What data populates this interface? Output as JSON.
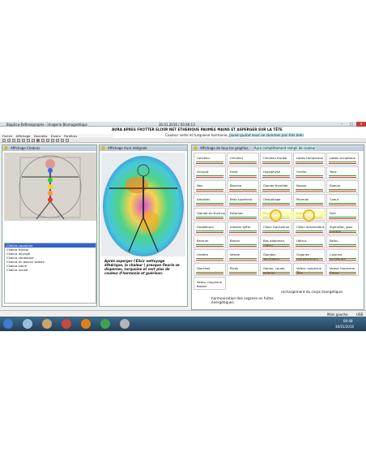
{
  "window": {
    "title": "Bioptica-Reflexographe - Imagerie Biomagnétique",
    "datetime": "30.01.2016 / 00:46:13"
  },
  "banner": {
    "line1": "AURA APRES FROTTER ELIXIR NET ETHERIQUE PAUMES MAINS ET ASPERGER SUR LA TÊTE",
    "line2_text": "Couleur verte et turquoise harmonie,",
    "line2_highlight": "Jaune quand nous ne sommes pas très bien"
  },
  "menu": [
    "Fichier",
    "Affichage",
    "Données",
    "Divers",
    "Fenêtres"
  ],
  "chakras_panel": {
    "title": "Affichage Chakras",
    "items": [
      "Chakra couronne",
      "Chakra frontal",
      "Chakra laryngé",
      "Chakra cardiaque",
      "Chakra du plexus solaire",
      "Chakra sacré",
      "Chakra racine"
    ]
  },
  "aura_panel": {
    "title": "Affichage Aura intégrale",
    "note": "Après asperger l'Élixir nettoyage éthérique, la chaleur ( presque fleurie se disperses, turquoise et vert plus de couleur d'harmonie et guérison."
  },
  "graphs_panel": {
    "title": "Affichage de tous les graphes",
    "banner": "Aura complètement rempli de couleur",
    "cells": [
      "Cerveau",
      "Cerveau",
      "Cerveau frontal",
      "Lobes temporaux",
      "Lobes occipitaux",
      "Occiput",
      "Front",
      "Hypophyse",
      "Oreille",
      "Yeux",
      "Nez",
      "Bouche",
      "Glande thyroïde",
      "Nuque",
      "Epaule",
      "Aisselles",
      "Bras supérieur",
      "Oesophage",
      "Poumon",
      "Coeur",
      "Glande du thymus",
      "Estomac",
      "Pancréas",
      "Rate",
      "Foie",
      "Duodénum",
      "Intestin grêle",
      "Côlon transverse",
      "Côlon descendant",
      "Sigmoïde, gros intestin",
      "Rectum",
      "Bassin",
      "Bas abdomen, région",
      "Utérus",
      "Reins",
      "Uretère",
      "Vessie",
      "Glandes surrénales",
      "Organes reproducteurs",
      "Colonne vertébrale",
      "Hanches",
      "Pieds",
      "Genou, coude, poignet",
      "Valeur moyenne Tête",
      "Valeur moyenne Corps"
    ],
    "last_cell": "Valeur moyenne Bassin",
    "caption_left": "harmonisation des organes en fuites énergétiques.",
    "caption_right": "rechargement du corps énergétique."
  },
  "status": {
    "hand": "Main gauche",
    "usb": "USB"
  },
  "tray": {
    "time": "00:48",
    "date": "30/01/2016"
  },
  "colors": {
    "highlight": "#c8f0f0",
    "taskbar": "#2f5272"
  }
}
